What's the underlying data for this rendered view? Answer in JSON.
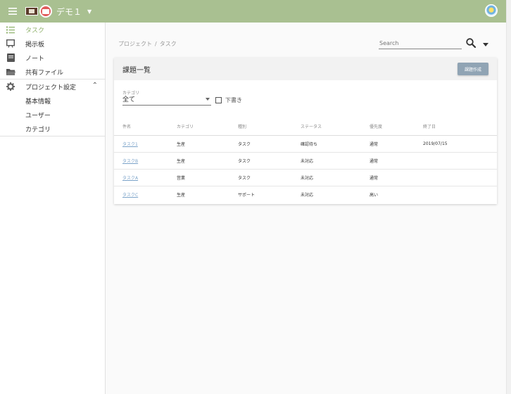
{
  "header": {
    "project_name": "デモ１",
    "icons": [
      "menu-icon",
      "project-icon-1",
      "project-icon-2",
      "user-avatar"
    ]
  },
  "sidebar": {
    "items": [
      {
        "label": "タスク",
        "icon": "task-list-icon",
        "active": true
      },
      {
        "label": "掲示板",
        "icon": "board-icon"
      },
      {
        "label": "ノート",
        "icon": "note-icon"
      },
      {
        "label": "共有ファイル",
        "icon": "folder-icon"
      },
      {
        "label": "プロジェクト設定",
        "icon": "gear-icon",
        "expanded": true
      }
    ],
    "subitems": [
      "基本情報",
      "ユーザー",
      "カテゴリ"
    ]
  },
  "breadcrumb": [
    "プロジェクト",
    "タスク"
  ],
  "search": {
    "placeholder": "Search"
  },
  "card": {
    "title": "課題一覧",
    "create_label": "課題作成",
    "filter": {
      "label": "カテゴリ",
      "value": "全て",
      "draft_label": "下書き"
    },
    "columns": [
      "件名",
      "カテゴリ",
      "種別",
      "ステータス",
      "優先度",
      "終了日"
    ],
    "rows": [
      {
        "name": "タスク1",
        "category": "生産",
        "type": "タスク",
        "status": "確認待ち",
        "priority": "通常",
        "end": "2019/07/15"
      },
      {
        "name": "タスクB",
        "category": "生産",
        "type": "タスク",
        "status": "未対応",
        "priority": "通常",
        "end": ""
      },
      {
        "name": "タスクA",
        "category": "営業",
        "type": "タスク",
        "status": "未対応",
        "priority": "通常",
        "end": ""
      },
      {
        "name": "タスクC",
        "category": "生産",
        "type": "サポート",
        "status": "未対応",
        "priority": "高い",
        "end": ""
      }
    ]
  },
  "colors": {
    "header": "#a9c091",
    "accent": "#8fb16b",
    "link": "#7ba3c9",
    "button": "#90a4b4"
  }
}
